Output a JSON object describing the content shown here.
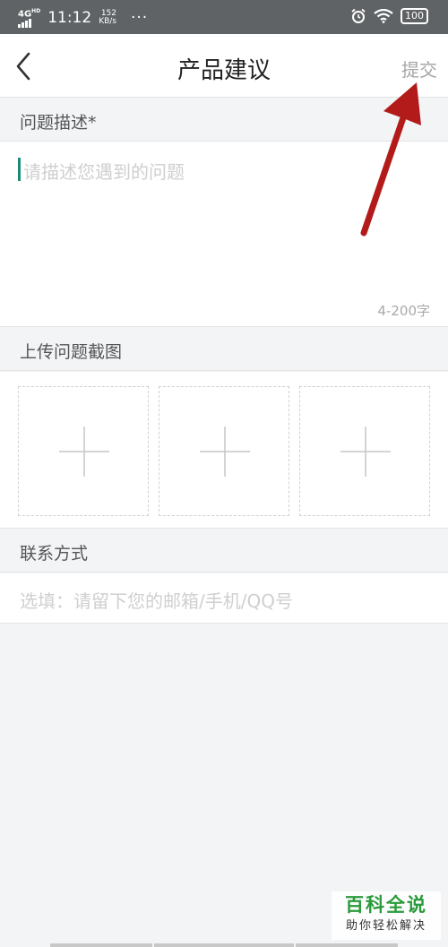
{
  "status_bar": {
    "network": "4G",
    "network_sup": "HD",
    "time": "11:12",
    "speed_value": "152",
    "speed_unit": "KB/s",
    "more": "···",
    "battery": "100"
  },
  "nav": {
    "back_icon": "chevron-left",
    "title": "产品建议",
    "submit_label": "提交"
  },
  "description": {
    "header": "问题描述*",
    "placeholder": "请描述您遇到的问题",
    "counter": "4-200字"
  },
  "screenshots": {
    "header": "上传问题截图",
    "slots": [
      "add-icon",
      "add-icon",
      "add-icon"
    ]
  },
  "contact": {
    "header": "联系方式",
    "placeholder": "选填：请留下您的邮箱/手机/QQ号"
  },
  "watermark": {
    "brand": "百科全说",
    "slogan": "助你轻松解决"
  },
  "colors": {
    "status_bar": "#5f6366",
    "background": "#f3f4f6",
    "cursor": "#1a8a7a",
    "watermark_brand": "#2a9a3a"
  }
}
